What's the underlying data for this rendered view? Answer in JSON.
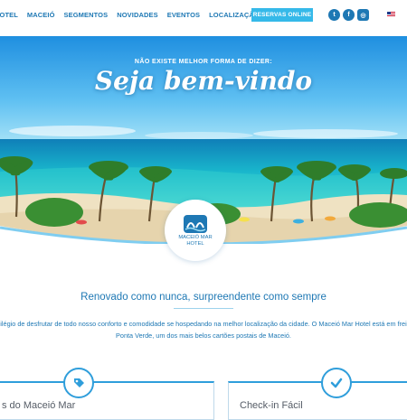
{
  "nav": {
    "items": [
      "HOTEL",
      "MACEIÓ",
      "SEGMENTOS",
      "NOVIDADES",
      "EVENTOS",
      "LOCALIZAÇÃO"
    ],
    "reserve_label": "RESERVAS ONLINE",
    "social": {
      "twitter": "t",
      "facebook": "f",
      "instagram": "◎"
    }
  },
  "hero": {
    "kicker": "NÃO EXISTE MELHOR FORMA DE DIZER:",
    "title": "Seja bem-vindo"
  },
  "logo": {
    "line1": "MACEIÓ MAR",
    "line2": "HOTEL"
  },
  "intro": {
    "tagline": "Renovado como nunca, surpreendente como sempre",
    "line1": "ilégio de desfrutar de todo nosso conforto e comodidade se hospedando na melhor localização da cidade. O Maceió Mar Hotel está em frei",
    "line2": "Ponta Verde, um dos mais belos cartões postais de Maceió."
  },
  "cards": [
    {
      "title": "s do Maceió Mar",
      "icon": "tag-icon"
    },
    {
      "title": "Check-in Fácil",
      "icon": "check-icon"
    }
  ],
  "colors": {
    "brand": "#1e78b4",
    "accent": "#35b9e9",
    "sea": "#1fb8cf",
    "sky": "#2a9be0"
  }
}
